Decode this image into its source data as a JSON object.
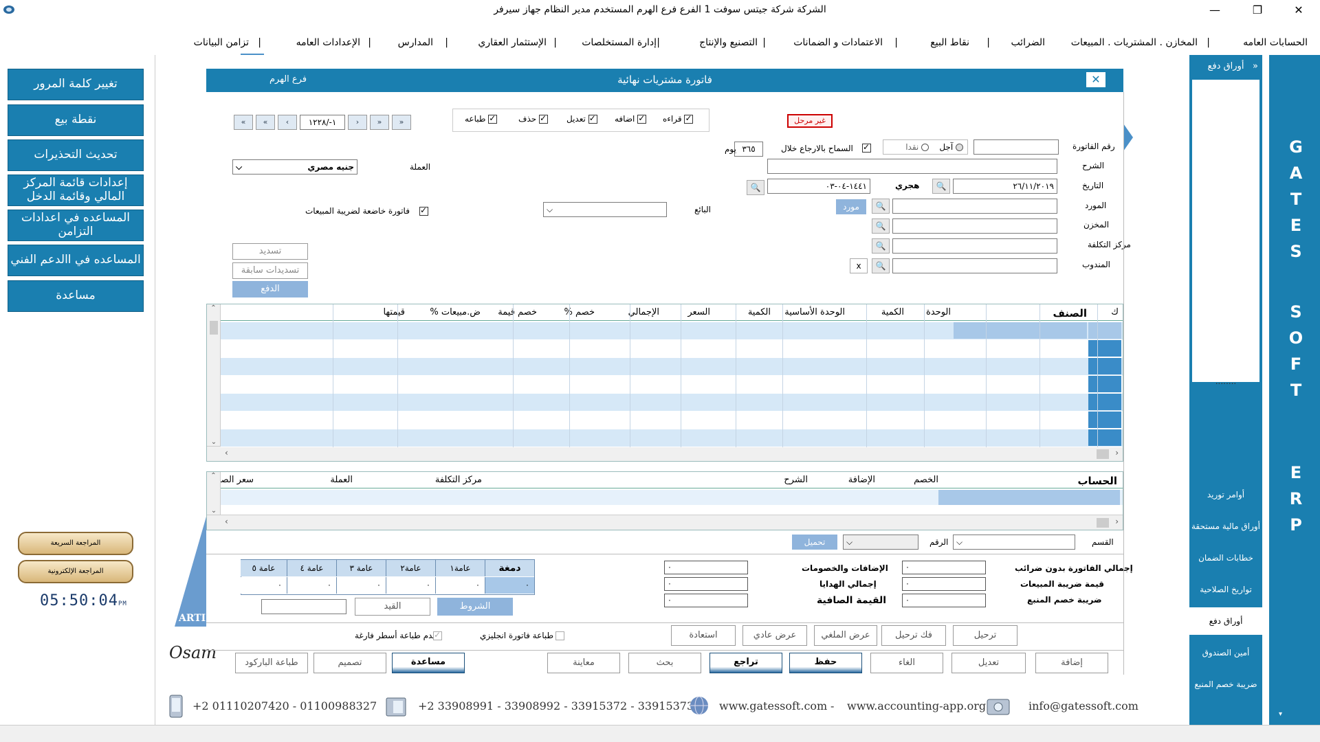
{
  "window": {
    "title": "الشركة شركة جيتس سوفت 1    الفرع فرع الهرم    المستخدم مدير النظام  جهاز سيرفر",
    "minimize": "—",
    "maximize": "❐",
    "close": "✕"
  },
  "menu": [
    "الحسابات العامه",
    "المخازن . المشتريات . المبيعات",
    "الضرائب",
    "نقاط البيع",
    "الاعتمادات و الضمانات",
    "التصنيع والإنتاج",
    "إدارة المستخلصات",
    "الإستثمار العقاري",
    "المدارس",
    "الإعدادات العامه",
    "تزامن البيانات"
  ],
  "left_panel": {
    "buttons": [
      "تغيير كلمة المرور",
      "نقطة بيع",
      "تحديث التحذيرات",
      "إعدادات قائمة المركز المالي وقائمة الدخل",
      "المساعده في اعدادات التزامن",
      "المساعده في االدعم الفني",
      "مساعدة"
    ],
    "gold_buttons": [
      "المراجعة السريعة",
      "المراجعة الإلكترونية"
    ],
    "clock": "05:50:04",
    "clock_ampm": "PM",
    "brand_text": "ARTI",
    "signature": "Osam"
  },
  "form": {
    "title": "فاتورة مشتريات نهائية",
    "branch": "فرع الهرم",
    "close_label": "✕",
    "status_badge": "غير مرحل",
    "permissions": [
      {
        "label": "قراءه",
        "checked": true
      },
      {
        "label": "اضافه",
        "checked": true
      },
      {
        "label": "تعديل",
        "checked": true
      },
      {
        "label": "حذف",
        "checked": true
      },
      {
        "label": "طباعه",
        "checked": true
      }
    ],
    "nav": {
      "first": "«",
      "prev_fast": "«",
      "prev": "‹",
      "record": "١-/١٢٢٨",
      "next": "›",
      "next_fast": "»",
      "last": "»"
    },
    "labels": {
      "invoice_no": "رقم الفاتورة",
      "description": "الشرح",
      "date": "التاريخ",
      "hijri": "هجري",
      "supplier": "المورد",
      "store": "المخزن",
      "cost_center": "مركز التكلفة",
      "rep": "المندوب",
      "currency": "العملة",
      "seller": "البائع",
      "credit": "آجل",
      "cash": "نقدا",
      "allow_return": "السماح بالارجاع خلال",
      "days": "يوم",
      "sales_tax_invoice": "فاتورة خاضعة لضريبة المبيعات",
      "supplier_btn": "مورد"
    },
    "values": {
      "date": "٢٦/١١/٢٠١٩",
      "hijri_date": "١٤٤١-٠٤-٠٣",
      "return_days": "٣٦٥",
      "currency": "جنيه مصري",
      "rep_clear": "x"
    },
    "pay_buttons": [
      "تسديد",
      "تسديدات سابقة",
      "الدفع"
    ]
  },
  "items_grid": {
    "headers": [
      "ك",
      "الصنف",
      "الوحدة",
      "الكمية",
      "الوحدة الأساسية",
      "الكمية",
      "السعر",
      "الإجمالي",
      "خصم %",
      "خصم قيمة",
      "ض.مبيعات %",
      "قيمتها"
    ]
  },
  "accounts_grid": {
    "headers": [
      "الحساب",
      "الخصم",
      "الإضافة",
      "الشرح",
      "مركز التكلفة",
      "العملة",
      "سعر الصرف"
    ]
  },
  "section": {
    "dept_label": "القسم",
    "number_label": "الرقم",
    "load_btn": "تحميل"
  },
  "totals": {
    "labels_right": [
      "إجمالي الفاتورة بدون ضرائب",
      "قيمة ضريبة المبيعات",
      "ضريبة خصم المنبع"
    ],
    "labels_mid": [
      "الإضافات والخصومات",
      "إجمالي الهدايا",
      "القيمة الصافية"
    ],
    "box_value": "٠",
    "tax_headers": [
      "دمغة",
      "عامة١",
      "عامة٢",
      "عامة ٣",
      "عامة ٤",
      "عامة ٥"
    ],
    "tax_values": [
      "٠",
      "٠",
      "٠",
      "٠",
      "٠",
      "٠"
    ],
    "conditions_btn": "الشروط",
    "entry_btn": "القيد"
  },
  "options": {
    "english_print": "طباعة فاتورة انجليزي",
    "no_empty_lines": "عدم طباعة أسطر فارغة"
  },
  "action_row1": [
    "ترحيل",
    "فك ترحيل",
    "عرض الملغي",
    "عرض عادي",
    "استعادة"
  ],
  "action_row2": [
    "إضافة",
    "تعديل",
    "الغاء",
    "حفظ",
    "تراجع",
    "بحث",
    "معاينة",
    "مساعدة",
    "تصميم",
    "طباعة الباركود"
  ],
  "footer": {
    "mobile": "+2 01110207420  - 01100988327",
    "phones": "+2 33908991 - 33908992 - 33915372 - 33915373",
    "web1": "www.gatessoft.com",
    "dash": "-",
    "web2": "www.accounting-app.org",
    "email": "info@gatessoft.com"
  },
  "right_panel": {
    "header": "أوراق دفع",
    "collapse": "«",
    "dots": "........",
    "items": [
      "أوامر توريد",
      "أوراق مالية مستحقة",
      "خطابات الضمان",
      "تواريخ الصلاحية",
      "أوراق دفع",
      "أمين الصندوق",
      "ضريبة خصم المنبع"
    ],
    "active_index": 4,
    "vertical_letters": [
      "G",
      "A",
      "T",
      "E",
      "S",
      "S",
      "O",
      "F",
      "T",
      "E",
      "R",
      "P"
    ]
  }
}
